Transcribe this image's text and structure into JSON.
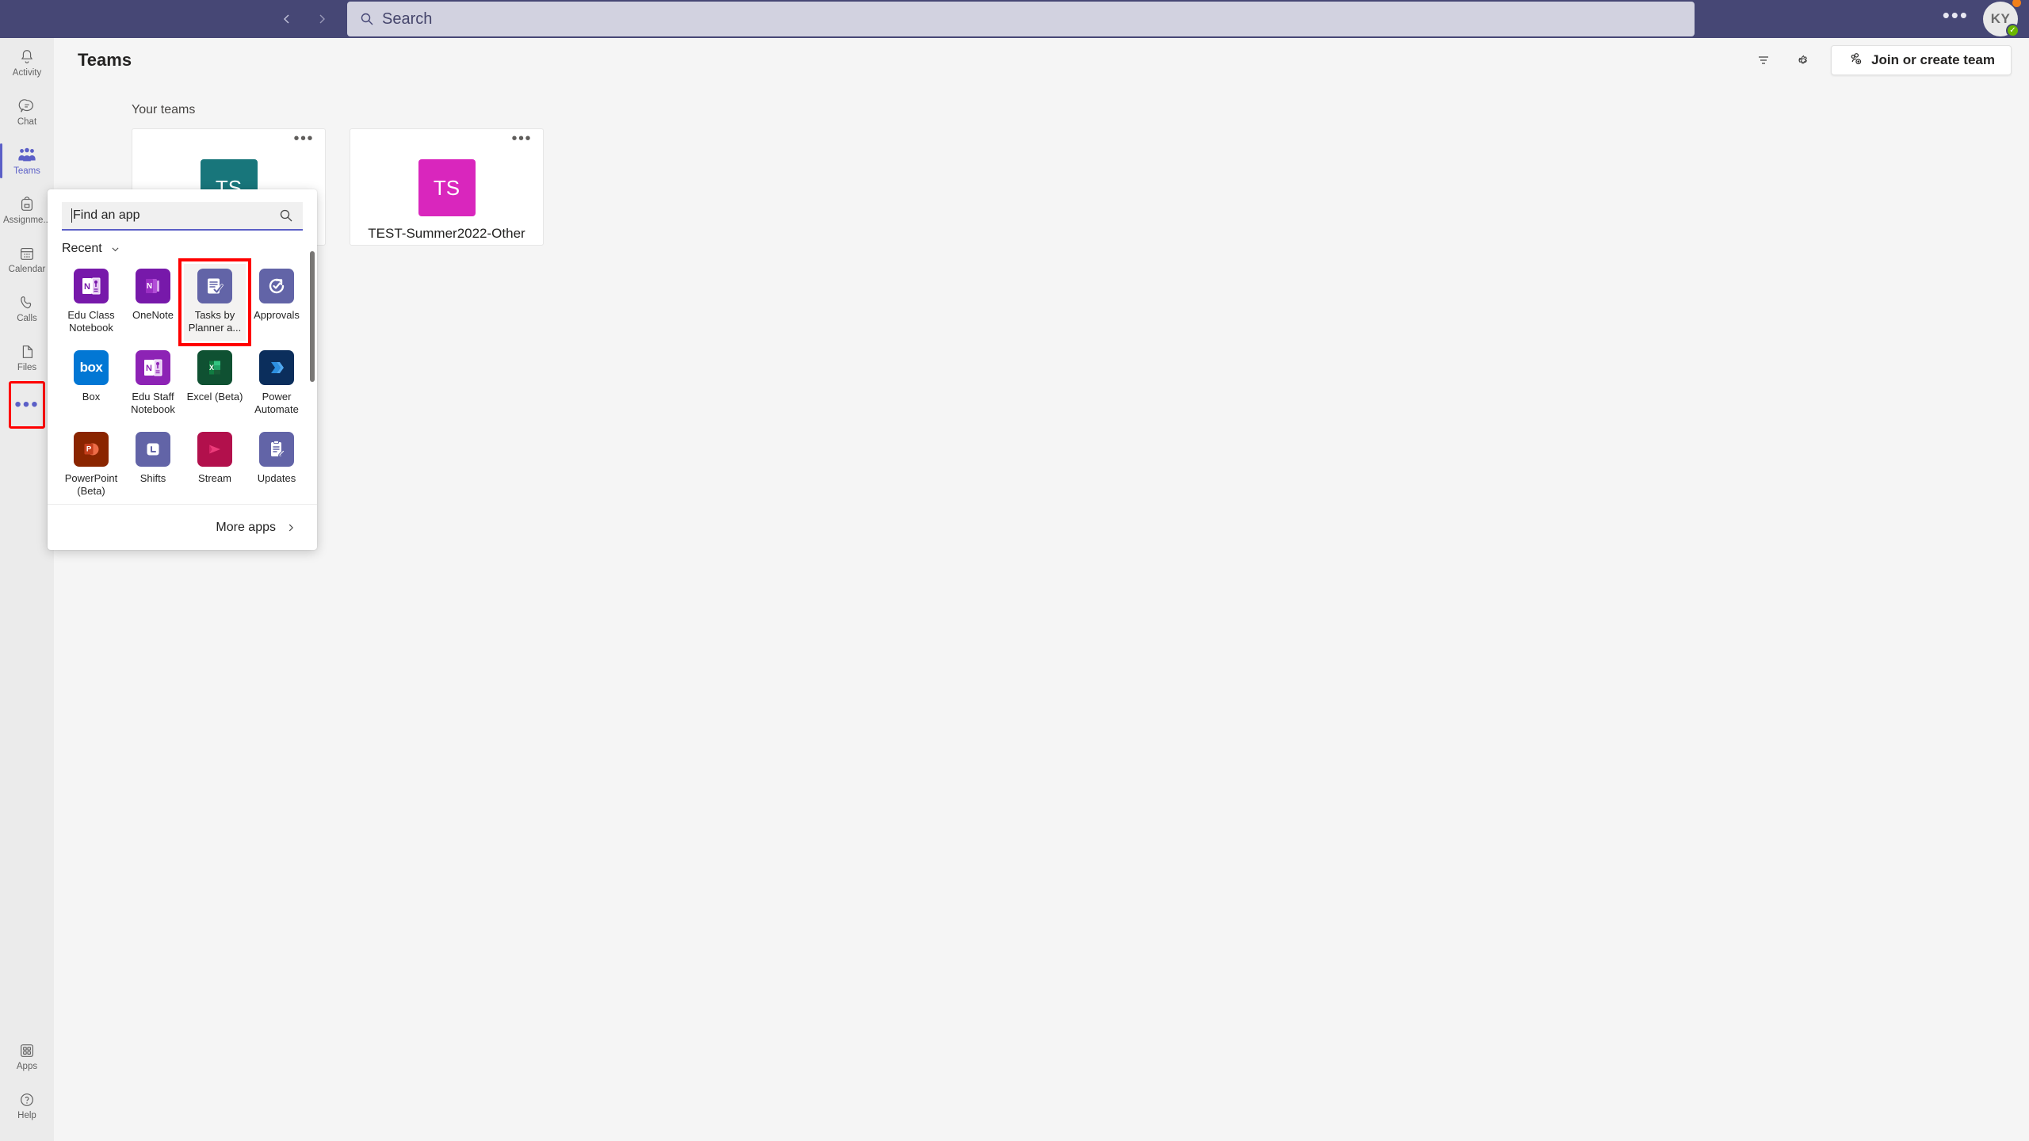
{
  "topbar": {
    "back_icon": "chevron-left-icon",
    "forward_icon": "chevron-right-icon",
    "search_placeholder": "Search",
    "search_icon": "search-icon",
    "more_label": "•••",
    "avatar_initials": "KY",
    "presence": "available",
    "presence_glyph": "✓"
  },
  "rail": {
    "items": [
      {
        "label": "Activity",
        "icon": "bell-icon",
        "active": false
      },
      {
        "label": "Chat",
        "icon": "chat-icon",
        "active": false
      },
      {
        "label": "Teams",
        "icon": "teams-people-icon",
        "active": true
      },
      {
        "label": "Assignme...",
        "icon": "backpack-icon",
        "active": false
      },
      {
        "label": "Calendar",
        "icon": "calendar-icon",
        "active": false
      },
      {
        "label": "Calls",
        "icon": "phone-icon",
        "active": false
      },
      {
        "label": "Files",
        "icon": "file-icon",
        "active": false
      }
    ],
    "more_button": {
      "label": "•••",
      "icon": "more-horizontal-icon",
      "highlighted": true
    },
    "bottom_items": [
      {
        "label": "Apps",
        "icon": "apps-grid-icon"
      },
      {
        "label": "Help",
        "icon": "help-question-icon"
      }
    ]
  },
  "header": {
    "title": "Teams",
    "filter_icon": "filter-icon",
    "settings_icon": "gear-icon",
    "join_create_label": "Join or create team",
    "join_create_icon": "add-people-icon"
  },
  "content": {
    "your_teams_label": "Your teams",
    "teams": [
      {
        "initials": "TS",
        "name": "",
        "color": "#18767b",
        "more_icon": "more-horizontal-icon"
      },
      {
        "initials": "TS",
        "name": "TEST-Summer2022-Other",
        "color": "#d926bd",
        "more_icon": "more-horizontal-icon"
      }
    ]
  },
  "app_flyout": {
    "search_placeholder": "Find an app",
    "search_icon": "search-icon",
    "section_label": "Recent",
    "section_chevron_icon": "chevron-down-icon",
    "more_apps_label": "More apps",
    "more_apps_chevron_icon": "chevron-right-icon",
    "scrollbar": "vertical-scrollbar",
    "apps": [
      {
        "label": "Edu Class Notebook",
        "icon": "edu-class-notebook-icon",
        "color": "#7719aa",
        "highlighted": false
      },
      {
        "label": "OneNote",
        "icon": "onenote-icon",
        "color": "#7719aa",
        "highlighted": false
      },
      {
        "label": "Tasks by Planner a...",
        "icon": "tasks-by-planner-icon",
        "color": "#6264a7",
        "highlighted": true
      },
      {
        "label": "Approvals",
        "icon": "approvals-icon",
        "color": "#6264a7",
        "highlighted": false
      },
      {
        "label": "Box",
        "icon": "box-icon",
        "color": "#0277d4",
        "highlighted": false
      },
      {
        "label": "Edu Staff Notebook",
        "icon": "edu-staff-notebook-icon",
        "color": "#7719aa",
        "highlighted": false
      },
      {
        "label": "Excel (Beta)",
        "icon": "excel-icon",
        "color": "#0f5132",
        "highlighted": false
      },
      {
        "label": "Power Automate",
        "icon": "power-automate-icon",
        "color": "#0b2e5c",
        "highlighted": false
      },
      {
        "label": "PowerPoint (Beta)",
        "icon": "powerpoint-icon",
        "color": "#8a2500",
        "highlighted": false
      },
      {
        "label": "Shifts",
        "icon": "shifts-icon",
        "color": "#6264a7",
        "highlighted": false
      },
      {
        "label": "Stream",
        "icon": "stream-icon",
        "color": "#b2104c",
        "highlighted": false
      },
      {
        "label": "Updates",
        "icon": "updates-icon",
        "color": "#6264a7",
        "highlighted": false
      }
    ]
  },
  "colors": {
    "brand_purple": "#464775",
    "accent": "#5b5fc7",
    "highlight_red": "#ff0000",
    "presence_green": "#6bb700",
    "notification_orange": "#f2801b"
  }
}
